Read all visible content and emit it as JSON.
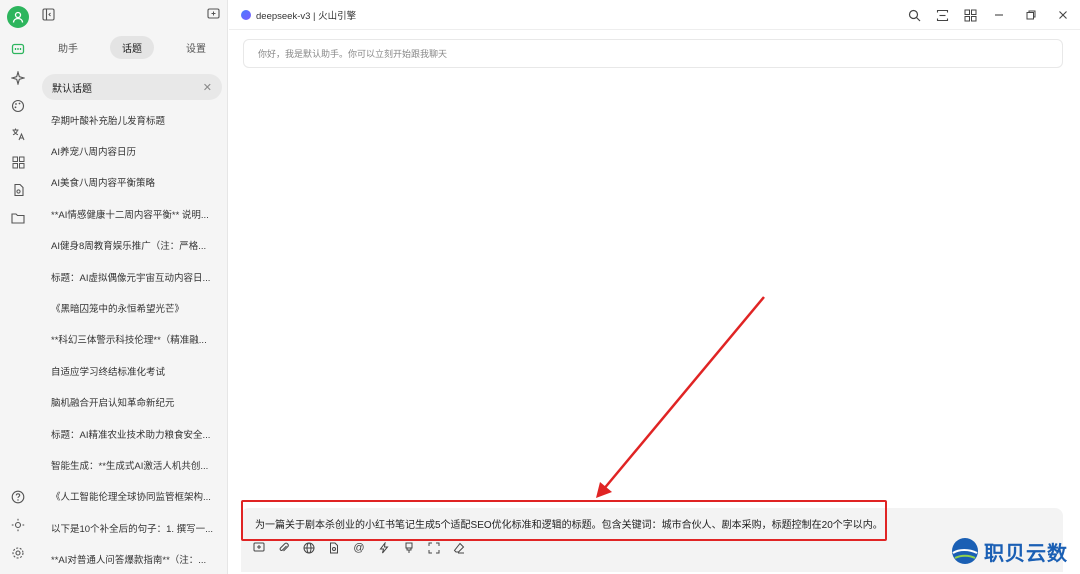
{
  "window": {
    "model_label": "deepseek-v3 | 火山引擎"
  },
  "panel": {
    "tabs": [
      {
        "label": "助手"
      },
      {
        "label": "话题"
      },
      {
        "label": "设置"
      }
    ],
    "active_topic": "默认话题",
    "topics": [
      "孕期叶酸补充胎儿发育标题",
      "AI养宠八周内容日历",
      "AI美食八周内容平衡策略",
      "**AI情感健康十二周内容平衡** 说明...",
      "AI健身8周教育娱乐推广（注：严格...",
      "标题：AI虚拟偶像元宇宙互动内容日...",
      "《黑暗囚笼中的永恒希望光芒》",
      "**科幻三体警示科技伦理**（精准融...",
      "自适应学习终结标准化考试",
      "脑机融合开启认知革命新纪元",
      "标题：AI精准农业技术助力粮食安全...",
      "智能生成：**生成式AI激活人机共创...",
      "《人工智能伦理全球协同监管框架构...",
      "以下是10个补全后的句子：1. 撰写一...",
      "**AI对普通人问答爆款指南**（注：..."
    ]
  },
  "main": {
    "greeting": "你好，我是默认助手。你可以立刻开始跟我聊天",
    "composer_text": "为一篇关于剧本杀创业的小红书笔记生成5个适配SEO优化标准和逻辑的标题。包含关键词：城市合伙人、剧本采购，标题控制在20个字以内。"
  },
  "watermark": {
    "text": "职贝云数"
  },
  "colors": {
    "accent_green": "#2db55d",
    "highlight_red": "#e02424",
    "watermark_blue": "#1a5fb4"
  }
}
